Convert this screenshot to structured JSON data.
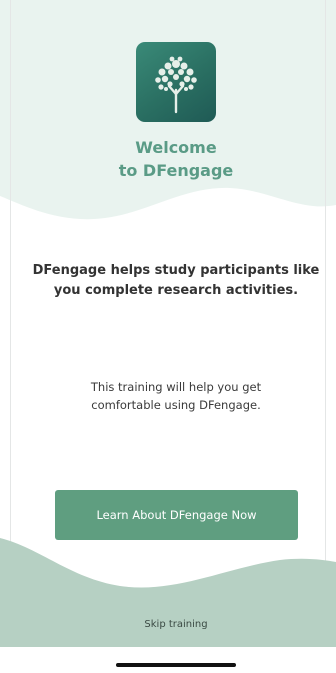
{
  "colors": {
    "accent": "#5a9b86",
    "button_bg": "#5f9e80",
    "light_wave": "#e8f2ee",
    "bottom_wave": "#b6d0c3"
  },
  "app_icon": {
    "icon_name": "tree-logo-icon"
  },
  "welcome": {
    "line1": "Welcome",
    "line2": "to DFengage"
  },
  "intro": {
    "line1": "DFengage helps study participants like",
    "line2": "you complete research activities."
  },
  "info": {
    "line1": "This training will help you get",
    "line2": "comfortable using DFengage."
  },
  "cta": {
    "label": "Learn About DFengage Now"
  },
  "skip": {
    "label": "Skip training"
  }
}
